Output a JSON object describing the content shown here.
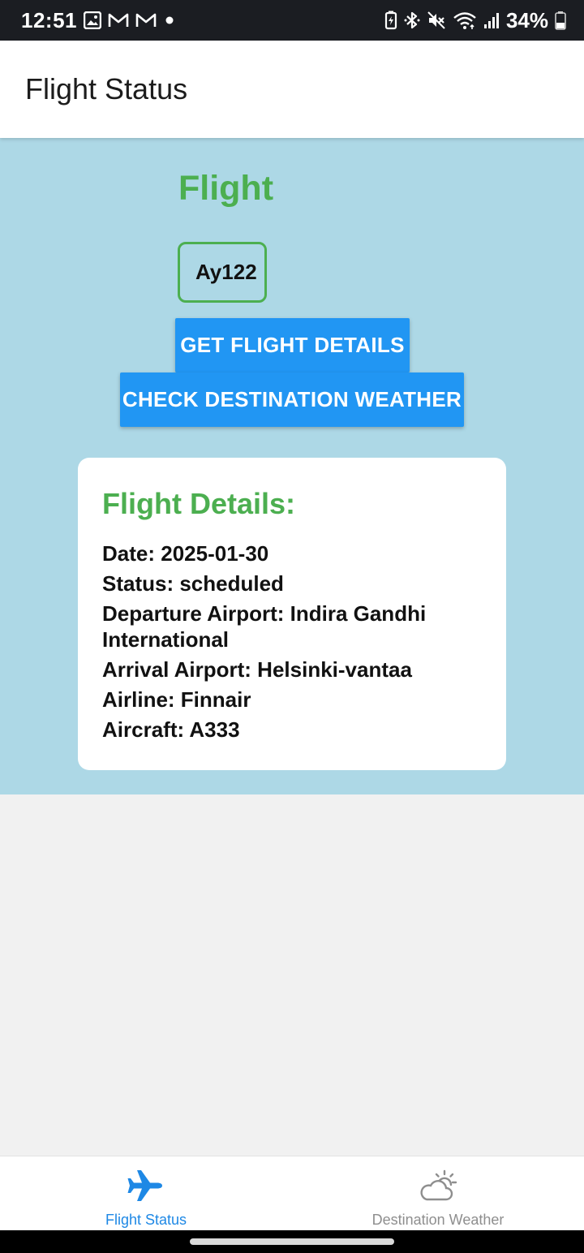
{
  "status_bar": {
    "time": "12:51",
    "battery": "34%",
    "left_icons": [
      "gallery-icon",
      "gmail-icon",
      "gmail-icon",
      "dot-icon"
    ],
    "right_icons": [
      "battery-saver-icon",
      "bluetooth-icon",
      "mute-icon",
      "wifi-icon",
      "signal-icon",
      "battery-icon"
    ]
  },
  "app_bar": {
    "title": "Flight Status"
  },
  "main": {
    "section_title": "Flight",
    "flight_input": {
      "value": "Ay122",
      "placeholder": ""
    },
    "buttons": {
      "get_details": "GET FLIGHT DETAILS",
      "check_weather": "CHECK DESTINATION WEATHER"
    },
    "details": {
      "heading": "Flight Details:",
      "lines": [
        "Date: 2025-01-30",
        "Status: scheduled",
        "Departure Airport: Indira Gandhi International",
        "Arrival Airport: Helsinki-vantaa",
        "Airline: Finnair",
        "Aircraft: A333"
      ]
    }
  },
  "bottom_nav": {
    "tabs": [
      {
        "label": "Flight Status",
        "icon": "airplane-icon",
        "active": true
      },
      {
        "label": "Destination Weather",
        "icon": "partly-cloudy-icon",
        "active": false
      }
    ]
  },
  "colors": {
    "accent_green": "#4caf50",
    "button_blue": "#2196f3",
    "panel_blue": "#add8e6",
    "nav_active": "#1e88e5",
    "nav_inactive": "#8e8e8e"
  }
}
